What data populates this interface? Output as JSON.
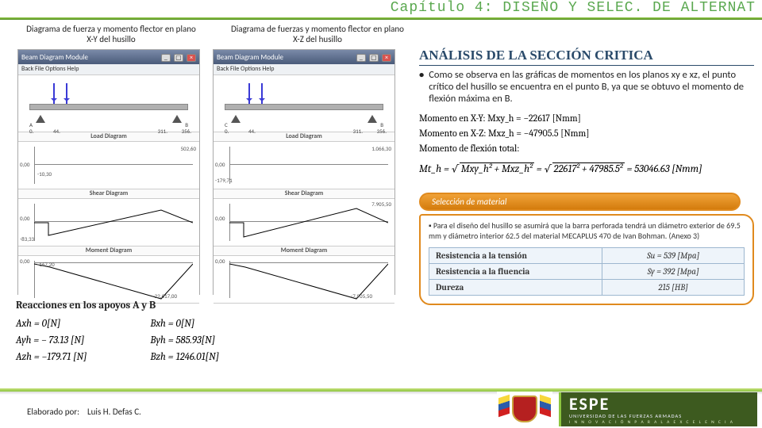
{
  "chapter": "Capítulo 4: DISEÑO Y SELEC. DE ALTERNAT",
  "col_left_title": "Diagrama de fuerza y momento flector en plano X-Y del husillo",
  "col_right_title": "Diagrama de fuerzas y momento flector en plano X-Z del husillo",
  "window": {
    "title": "Beam Diagram Module",
    "menu": "Back  File  Options  Help",
    "ticks_left": {
      "a": "0.",
      "b": "44.",
      "c": "311.",
      "d": "356."
    },
    "ticks_right": {
      "a": "0.",
      "b": "44.",
      "c": "311.",
      "d": "356."
    },
    "markers_left": {
      "l": "A",
      "r": "B"
    },
    "markers_right": {
      "l": "C",
      "r": "B"
    },
    "load_hdr": "Load Diagram",
    "shear_hdr": "Shear Diagram",
    "moment_hdr": "Moment Diagram",
    "left_vals": {
      "l1": "502,60",
      "l2": "0,00",
      "l3": "-10,30",
      "s1": "0,00",
      "s2": "-83,33",
      "m1": "0,00",
      "m2": "-167,20",
      "m3": "-22.617,00"
    },
    "right_vals": {
      "l1": "1.066,30",
      "l2": "0,00",
      "l3": "-179,71",
      "s1": "7.905,50",
      "s2": "0,00",
      "m1": "-7.905,50",
      "mm": "0,00"
    }
  },
  "reactions": {
    "header": "Reacciones en los apoyos A y B",
    "left": [
      "Axh = 0[N]",
      "Ayh = − 73.13 [N]",
      "Azh = −179.71 [N]"
    ],
    "right": [
      "Bxh = 0[N]",
      "Byh = 585.93[N]",
      "Bzh = 1246.01[N]"
    ]
  },
  "analysis": {
    "title": "ANÁLISIS DE LA SECCIÓN CRITICA",
    "bullet": "Como se observa en las gráficas de momentos en los planos xy e xz, el punto crítico del husillo se encuentra en el punto B, ya que se obtuvo el momento de flexión máxima en B.",
    "mxy": "Momento en X-Y: Mxy_h = −22617 [Nmm]",
    "mxz": "Momento en X-Z: Mxz_h = −47905.5 [Nmm]",
    "mtot_label": "Momento de flexión total:",
    "formula_lhs": "Mt_h =",
    "formula_sqrt1": "Mxy_h² + Mxz_h²",
    "formula_sqrt2": "22617² + 47985.5²",
    "formula_result": "= 53046.63 [Nmm]"
  },
  "material": {
    "pill": "Selección de material",
    "note": "Para el diseño del husillo se asumirá que la barra perforada tendrá un diámetro exterior de 69.5 mm y diámetro interior 62.5 del material MECAPLUS 470 de Ivan Bohman. (Anexo 3)",
    "table": [
      {
        "k": "Resistencia a la tensión",
        "v": "Su = 539 [Mpa]"
      },
      {
        "k": "Resistencia a la fluencia",
        "v": "Sy = 392 [Mpa]"
      },
      {
        "k": "Dureza",
        "v": "215 [HB]"
      }
    ]
  },
  "footer": {
    "elab_label": "Elaborado por:",
    "elab_name": "Luis H. Defas C.",
    "brand": "ESPE",
    "brand_sub": "UNIVERSIDAD DE LAS FUERZAS ARMADAS",
    "brand_motto": "I N N O V A C I Ó N   P A R A   L A   E X C E L E N C I A"
  }
}
